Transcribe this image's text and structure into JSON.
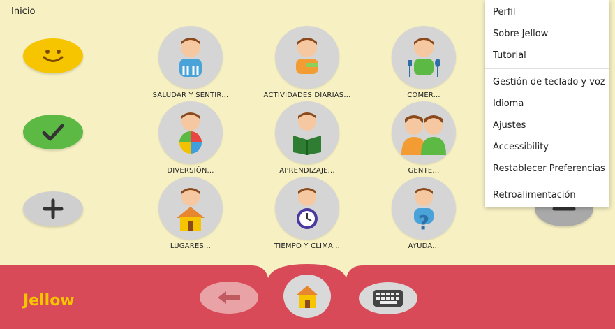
{
  "header": {
    "title": "Inicio"
  },
  "expressive": {
    "happy_icon": "smiley-icon",
    "yes_icon": "check-icon",
    "more_icon": "plus-icon",
    "less_icon": "minus-icon"
  },
  "categories": [
    {
      "label": "SALUDAR Y SENTIR...",
      "icon": "greeting-icon"
    },
    {
      "label": "ACTIVIDADES DIARIAS...",
      "icon": "daily-activities-icon"
    },
    {
      "label": "COMER...",
      "icon": "eating-icon"
    },
    {
      "label": "DIVERSIÓN...",
      "icon": "fun-icon"
    },
    {
      "label": "APRENDIZAJE...",
      "icon": "learning-icon"
    },
    {
      "label": "GENTE...",
      "icon": "people-icon"
    },
    {
      "label": "LUGARES...",
      "icon": "places-icon"
    },
    {
      "label": "TIEMPO Y CLIMA...",
      "icon": "time-weather-icon"
    },
    {
      "label": "AYUDA...",
      "icon": "help-icon"
    }
  ],
  "menu": {
    "items": [
      "Perfil",
      "Sobre Jellow",
      "Tutorial",
      "Gestión de teclado y voz",
      "Idioma",
      "Ajustes",
      "Accessibility",
      "Restablecer Preferencias",
      "Retroalimentación"
    ]
  },
  "bottom": {
    "logo_text": "Jellow",
    "back_icon": "back-arrow-icon",
    "home_icon": "home-icon",
    "keyboard_icon": "keyboard-icon"
  },
  "colors": {
    "background": "#f6f0c3",
    "bar": "#d94a58",
    "happy": "#f7c500",
    "check": "#5cb944",
    "neutral": "#cfcfcf"
  }
}
